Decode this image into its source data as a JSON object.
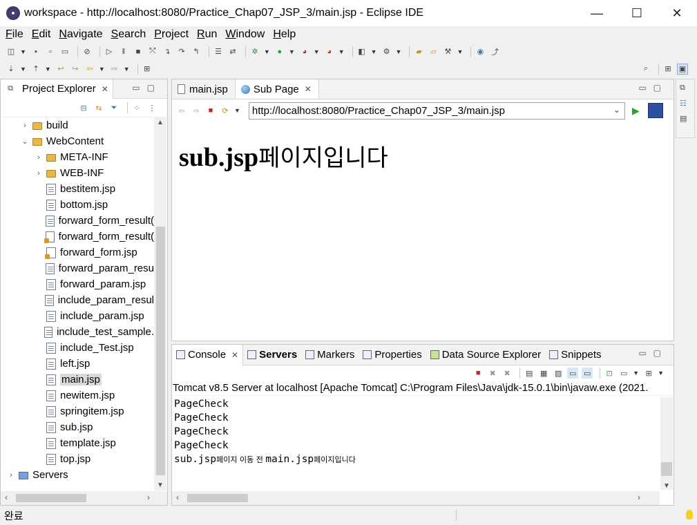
{
  "window": {
    "title": "workspace - http://localhost:8080/Practice_Chap07_JSP_3/main.jsp - Eclipse IDE",
    "minimize": "—",
    "maximize": "☐",
    "close": "✕"
  },
  "menu": [
    "File",
    "Edit",
    "Navigate",
    "Search",
    "Project",
    "Run",
    "Window",
    "Help"
  ],
  "project_explorer": {
    "tab_label": "Project Explorer",
    "tree": [
      {
        "label": "build",
        "type": "folder",
        "indent": 1,
        "twisty": "›"
      },
      {
        "label": "WebContent",
        "type": "folder",
        "indent": 1,
        "twisty": "⌄"
      },
      {
        "label": "META-INF",
        "type": "folder",
        "indent": 2,
        "twisty": "›"
      },
      {
        "label": "WEB-INF",
        "type": "folder",
        "indent": 2,
        "twisty": "›"
      },
      {
        "label": "bestitem.jsp",
        "type": "file",
        "indent": 2
      },
      {
        "label": "bottom.jsp",
        "type": "file",
        "indent": 2
      },
      {
        "label": "forward_form_result(",
        "type": "file",
        "indent": 2
      },
      {
        "label": "forward_form_result(",
        "type": "jspw",
        "indent": 2
      },
      {
        "label": "forward_form.jsp",
        "type": "jspw",
        "indent": 2
      },
      {
        "label": "forward_param_resu",
        "type": "file",
        "indent": 2
      },
      {
        "label": "forward_param.jsp",
        "type": "file",
        "indent": 2
      },
      {
        "label": "include_param_resul",
        "type": "file",
        "indent": 2
      },
      {
        "label": "include_param.jsp",
        "type": "file",
        "indent": 2
      },
      {
        "label": "include_test_sample.",
        "type": "file",
        "indent": 2
      },
      {
        "label": "include_Test.jsp",
        "type": "file",
        "indent": 2
      },
      {
        "label": "left.jsp",
        "type": "file",
        "indent": 2
      },
      {
        "label": "main.jsp",
        "type": "file",
        "indent": 2,
        "selected": true
      },
      {
        "label": "newitem.jsp",
        "type": "file",
        "indent": 2
      },
      {
        "label": "springitem.jsp",
        "type": "file",
        "indent": 2
      },
      {
        "label": "sub.jsp",
        "type": "file",
        "indent": 2
      },
      {
        "label": "template.jsp",
        "type": "file",
        "indent": 2
      },
      {
        "label": "top.jsp",
        "type": "file",
        "indent": 2
      },
      {
        "label": "Servers",
        "type": "servers",
        "indent": 0,
        "twisty": "›"
      }
    ]
  },
  "editor": {
    "tabs": [
      {
        "label": "main.jsp",
        "icon": "jsp-file-icon",
        "active": false
      },
      {
        "label": "Sub Page",
        "icon": "globe-icon",
        "active": true
      }
    ],
    "url": "http://localhost:8080/Practice_Chap07_JSP_3/main.jsp",
    "page_text_latin": "sub.jsp",
    "page_text_korean": "페이지입니다"
  },
  "console": {
    "tabs": [
      {
        "label": "Console",
        "active": true,
        "bold": false
      },
      {
        "label": "Servers",
        "active": false,
        "bold": true
      },
      {
        "label": "Markers",
        "active": false,
        "bold": false
      },
      {
        "label": "Properties",
        "active": false,
        "bold": false
      },
      {
        "label": "Data Source Explorer",
        "active": false,
        "bold": false
      },
      {
        "label": "Snippets",
        "active": false,
        "bold": false
      }
    ],
    "description": "Tomcat v8.5 Server at localhost [Apache Tomcat] C:\\Program Files\\Java\\jdk-15.0.1\\bin\\javaw.exe  (2021.",
    "lines": [
      "PageCheck",
      "PageCheck",
      "PageCheck",
      "PageCheck"
    ],
    "last_line": {
      "a": "sub.jsp",
      "b": "페이지 이동 전 ",
      "c": "main.jsp",
      "d": "페이지입니다"
    }
  },
  "status": {
    "text": "완료"
  }
}
